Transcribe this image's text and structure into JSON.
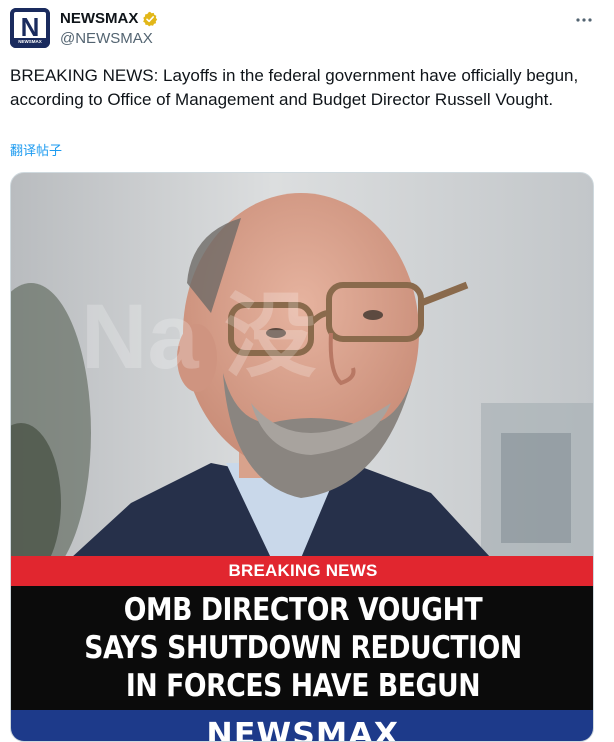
{
  "post": {
    "author": {
      "display_name": "NEWSMAX",
      "handle": "@NEWSMAX",
      "avatar_letter": "N",
      "avatar_caption": "NEWSMAX",
      "verified_icon": "verified-gold-badge-icon"
    },
    "more_icon": "more-horizontal-icon",
    "text": "BREAKING NEWS: Layoffs in the federal government have officially begun, according to Office of Management and Budget Director Russell Vought.",
    "translate_label": "翻译帖子"
  },
  "media": {
    "watermark": "Na  没",
    "banner_label": "BREAKING NEWS",
    "headline_lines": [
      "OMB DIRECTOR VOUGHT",
      "SAYS SHUTDOWN REDUCTION",
      "IN FORCES HAVE BEGUN"
    ],
    "brand": "NEWSMAX"
  },
  "colors": {
    "accent_link": "#1d9bf0",
    "verified_gold": "#e2b719",
    "banner_red": "#e1262f",
    "banner_black": "#0b0b0b",
    "brand_blue": "#1d3a8a"
  }
}
